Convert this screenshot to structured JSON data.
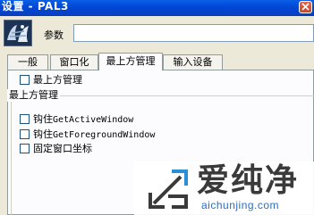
{
  "window": {
    "title": "设置 - PAL3"
  },
  "params": {
    "label": "参数",
    "value": ""
  },
  "tabs": [
    {
      "label": "一般",
      "active": false
    },
    {
      "label": "窗口化",
      "active": false
    },
    {
      "label": "最上方管理",
      "active": true
    },
    {
      "label": "输入设备",
      "active": false
    }
  ],
  "panel": {
    "top_checkbox": {
      "label": "最上方管理",
      "checked": false
    },
    "group": {
      "legend": "最上方管理",
      "items": [
        {
          "prefix": "钩住",
          "label": "GetActiveWindow",
          "checked": false
        },
        {
          "prefix": "钩住",
          "label": "GetForegroundWindow",
          "checked": false
        },
        {
          "prefix": "",
          "label": "固定窗口坐标",
          "checked": false
        }
      ]
    }
  },
  "watermark": {
    "title": "爱纯净",
    "url": "aichunjing.com"
  },
  "colors": {
    "titlebar": "#0046d5",
    "window_bg": "#ece9d8",
    "panel_bg": "#fcfcfe",
    "close_button": "#c8452a",
    "watermark_url": "#2b6ec2"
  },
  "icons": [
    "close-icon",
    "app-icon",
    "watermark-logo-icon"
  ]
}
